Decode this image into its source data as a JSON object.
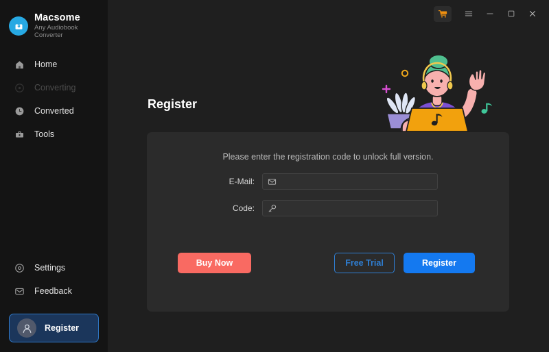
{
  "brand": {
    "name": "Macsome",
    "subtitle": "Any Audiobook Converter",
    "logo_icon": "audiobook-logo-icon",
    "logo_color": "#27a9e3"
  },
  "titlebar": {
    "buttons": [
      {
        "name": "cart-icon",
        "label": "",
        "color": "#f0900f"
      },
      {
        "name": "menu-icon",
        "label": ""
      },
      {
        "name": "minimize-icon",
        "label": ""
      },
      {
        "name": "maximize-icon",
        "label": ""
      },
      {
        "name": "close-icon",
        "label": ""
      }
    ]
  },
  "sidebar": {
    "items": [
      {
        "label": "Home",
        "icon": "home-icon",
        "state": "normal"
      },
      {
        "label": "Converting",
        "icon": "converting-icon",
        "state": "disabled"
      },
      {
        "label": "Converted",
        "icon": "clock-icon",
        "state": "normal"
      },
      {
        "label": "Tools",
        "icon": "toolbox-icon",
        "state": "normal"
      }
    ],
    "bottom_items": [
      {
        "label": "Settings",
        "icon": "gear-icon"
      },
      {
        "label": "Feedback",
        "icon": "feedback-icon"
      }
    ],
    "register": {
      "label": "Register",
      "icon": "user-avatar-icon",
      "accent": "#2f76c4",
      "background": "#1b365b"
    }
  },
  "main": {
    "page_title": "Register",
    "hint": "Please enter the registration code to unlock full version.",
    "form": {
      "email": {
        "label": "E-Mail:",
        "value": "",
        "placeholder": "",
        "icon": "envelope-icon"
      },
      "code": {
        "label": "Code:",
        "value": "",
        "placeholder": "",
        "icon": "key-icon"
      }
    },
    "buttons": {
      "buy_now": {
        "label": "Buy Now",
        "color": "#f96a62"
      },
      "free_trial": {
        "label": "Free Trial",
        "color": "#2f7fd4"
      },
      "register": {
        "label": "Register",
        "color": "#1479f0"
      }
    }
  },
  "illustration": {
    "name": "person-with-laptop-illustration",
    "colors": {
      "skin": "#f7b0ae",
      "hat": "#4fbf8f",
      "shirt": "#7b4fd4",
      "laptop": "#f2a10d",
      "note": "#3fc89a",
      "plus": "#d94fd4",
      "dot": "#f0a81c"
    }
  }
}
